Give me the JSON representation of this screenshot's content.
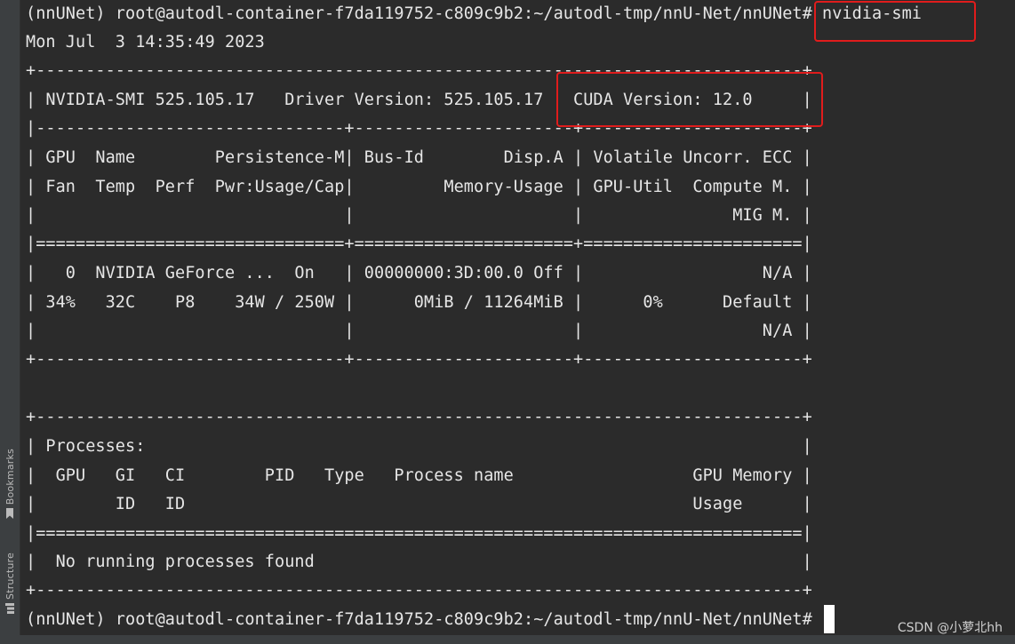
{
  "sidebar": {
    "bookmarks_label": "Bookmarks",
    "structure_label": "Structure"
  },
  "terminal": {
    "lines": [
      "(nnUNet) root@autodl-container-f7da119752-c809c9b2:~/autodl-tmp/nnU-Net/nnUNet# nvidia-smi",
      "Mon Jul  3 14:35:49 2023",
      "+-----------------------------------------------------------------------------+",
      "| NVIDIA-SMI 525.105.17   Driver Version: 525.105.17   CUDA Version: 12.0     |",
      "|-------------------------------+----------------------+----------------------+",
      "| GPU  Name        Persistence-M| Bus-Id        Disp.A | Volatile Uncorr. ECC |",
      "| Fan  Temp  Perf  Pwr:Usage/Cap|         Memory-Usage | GPU-Util  Compute M. |",
      "|                               |                      |               MIG M. |",
      "|===============================+======================+======================|",
      "|   0  NVIDIA GeForce ...  On   | 00000000:3D:00.0 Off |                  N/A |",
      "| 34%   32C    P8    34W / 250W |      0MiB / 11264MiB |      0%      Default |",
      "|                               |                      |                  N/A |",
      "+-------------------------------+----------------------+----------------------+",
      "",
      "",
      "+-----------------------------------------------------------------------------+",
      "| Processes:                                                                  |",
      "|  GPU   GI   CI        PID   Type   Process name                  GPU Memory |",
      "|        ID   ID                                                   Usage      |",
      "|=============================================================================|",
      "|  No running processes found                                                 |",
      "+-----------------------------------------------------------------------------+",
      "(nnUNet) root@autodl-container-f7da119752-c809c9b2:~/autodl-tmp/nnU-Net/nnUNet# "
    ]
  },
  "watermark": {
    "text": "CSDN @小萝北hh"
  },
  "colors": {
    "background": "#2b2b2b",
    "text": "#e6e6e6",
    "highlight": "#e01c1c",
    "sidebar": "#3c3f41"
  }
}
